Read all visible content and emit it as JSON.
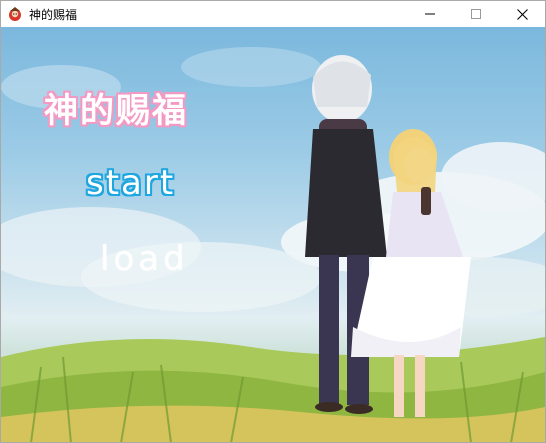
{
  "window": {
    "title": "神的赐福",
    "icon": "game-icon"
  },
  "controls": {
    "minimize_icon": "minimize-icon",
    "maximize_icon": "maximize-icon",
    "close_icon": "close-icon"
  },
  "game": {
    "title": "神的赐福",
    "menu": {
      "start_label": "start",
      "load_label": "load"
    },
    "colors": {
      "title_outline": "#f39ac4",
      "start_outline": "#1ea6e0",
      "sky": "#8ec3e2",
      "grass": "#9dc24a"
    }
  }
}
